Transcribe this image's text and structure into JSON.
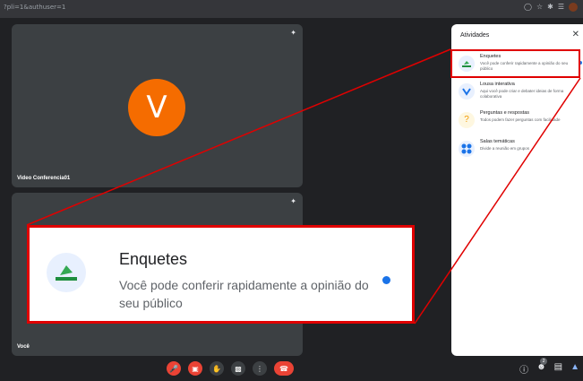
{
  "browser": {
    "url_fragment": "?pli=1&authuser=1"
  },
  "tiles": [
    {
      "name": "Video Conferencia01",
      "avatar_letter": "V",
      "avatar_color": "#f56c00"
    },
    {
      "name": "Você"
    }
  ],
  "panel": {
    "title": "Atividades",
    "items": [
      {
        "name": "Enquetes",
        "description": "Você pode conferir rapidamente a opinião do seu público",
        "icon": "poll-icon",
        "new_dot": true
      },
      {
        "name": "Lousa interativa",
        "description": "Aqui você pode criar e debater ideias de forma colaborativa",
        "icon": "whiteboard-icon"
      },
      {
        "name": "Perguntas e respostas",
        "description": "Todos podem fazer perguntas com facilidade",
        "icon": "question-icon"
      },
      {
        "name": "Salas temáticas",
        "description": "Divide a reunião em grupos",
        "icon": "breakout-rooms-icon"
      }
    ]
  },
  "zoom_callout": {
    "title": "Enquetes",
    "description": "Você pode conferir rapidamente a opinião do seu público"
  },
  "controls": {
    "items": [
      "mic-off-icon",
      "camera-off-icon",
      "raise-hand-icon",
      "present-icon",
      "more-options-icon",
      "hang-up-icon"
    ],
    "participants_count": "2"
  },
  "colors": {
    "accent": "#1a73e8",
    "highlight": "#e00000",
    "danger": "#ea4335"
  }
}
